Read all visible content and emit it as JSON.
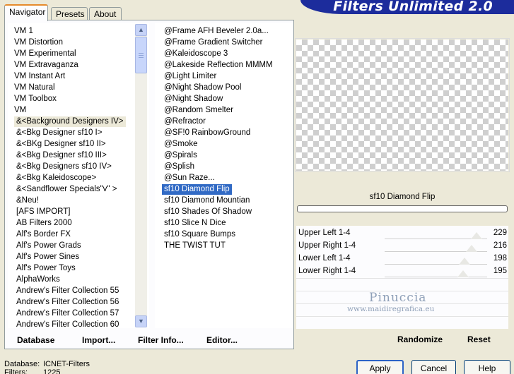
{
  "banner_title": "Filters Unlimited 2.0",
  "tabs": [
    "Navigator",
    "Presets",
    "About"
  ],
  "categories": [
    "VM 1",
    "VM Distortion",
    "VM Experimental",
    "VM Extravaganza",
    "VM Instant Art",
    "VM Natural",
    "VM Toolbox",
    "VM",
    "&<Background Designers IV>",
    "&<Bkg Designer sf10 I>",
    "&<BKg Designer sf10 II>",
    "&<Bkg Designer sf10 III>",
    "&<Bkg Designers sf10 IV>",
    "&<Bkg Kaleidoscope>",
    "&<Sandflower Specials\"v\" >",
    "&Neu!",
    "[AFS IMPORT]",
    "AB Filters 2000",
    "Alf's Border FX",
    "Alf's Power Grads",
    "Alf's Power Sines",
    "Alf's Power Toys",
    "AlphaWorks",
    "Andrew's Filter Collection 55",
    "Andrew's Filter Collection 56",
    "Andrew's Filter Collection 57",
    "Andrew's Filter Collection 60"
  ],
  "selected_category": "&<Background Designers IV>",
  "filters": [
    "@Frame AFH Beveler 2.0a...",
    "@Frame Gradient Switcher",
    "@Kaleidoscope 3",
    "@Lakeside Reflection MMMM",
    "@Light Limiter",
    "@Night Shadow Pool",
    "@Night Shadow",
    "@Random Smelter",
    "@Refractor",
    "@SF!0 RainbowGround",
    "@Smoke",
    "@Spirals",
    "@Splish",
    "@Sun Raze...",
    "sf10 Diamond Flip",
    "sf10 Diamond Mountian",
    "sf10 Shades Of Shadow",
    "sf10 Slice N Dice",
    "sf10 Square Bumps",
    "THE TWIST TUT"
  ],
  "selected_filter": "sf10 Diamond Flip",
  "list_buttons": {
    "database": "Database",
    "import": "Import...",
    "filter_info": "Filter Info...",
    "editor": "Editor..."
  },
  "preview_filter_name": "sf10 Diamond Flip",
  "progress_fraction": 0,
  "sliders": [
    {
      "label": "Upper Left 1-4",
      "value": 229
    },
    {
      "label": "Upper Right 1-4",
      "value": 216
    },
    {
      "label": "Lower Left 1-4",
      "value": 198
    },
    {
      "label": "Lower Right 1-4",
      "value": 195
    }
  ],
  "slider_max": 255,
  "watermark": {
    "name": "Pinuccia",
    "url": "www.maidiregrafica.eu"
  },
  "actions": {
    "randomize": "Randomize",
    "reset": "Reset"
  },
  "info": {
    "database_label": "Database:",
    "database_value": "ICNET-Filters",
    "filters_label": "Filters:",
    "filters_value": "1225"
  },
  "dialog_buttons": {
    "apply": "Apply",
    "cancel": "Cancel",
    "help": "Help"
  },
  "colors": {
    "banner": "#1c2c9c",
    "selection": "#316ac5",
    "tab_accent": "#e68b2c"
  }
}
